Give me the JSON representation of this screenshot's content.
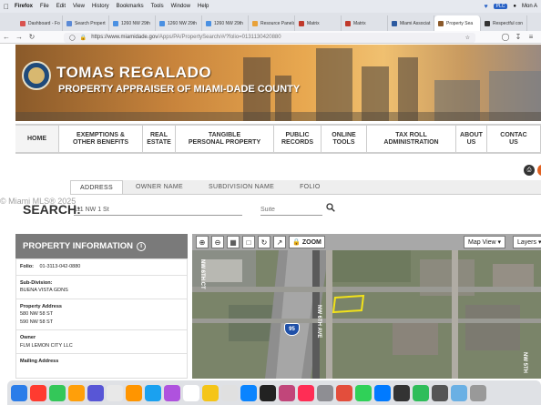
{
  "menubar": {
    "app": "Firefox",
    "items": [
      "File",
      "Edit",
      "View",
      "History",
      "Bookmarks",
      "Tools",
      "Window",
      "Help"
    ],
    "status": "PLC",
    "clock": "Mon A"
  },
  "tabs": [
    {
      "label": "Dashboard - Fo",
      "color": "#d9534f"
    },
    {
      "label": "Search Propert",
      "color": "#5b8ad6"
    },
    {
      "label": "1260 NW 29th",
      "color": "#4a90e2"
    },
    {
      "label": "1260 NW 29th",
      "color": "#4a90e2"
    },
    {
      "label": "1260 NW 29th",
      "color": "#4a90e2"
    },
    {
      "label": "Resource Panels",
      "color": "#e8a23a"
    },
    {
      "label": "Matrix",
      "color": "#c0392b"
    },
    {
      "label": "Matrix",
      "color": "#c0392b"
    },
    {
      "label": "Miami Associat",
      "color": "#2c5aa0"
    },
    {
      "label": "Property Sea",
      "color": "#8b5a2b",
      "active": true
    },
    {
      "label": "Respectful con",
      "color": "#333"
    }
  ],
  "url": {
    "host": "https://www.miamidade.gov",
    "path": "/Apps/PA/PropertySearch/#/?folio=0131130420880"
  },
  "banner": {
    "title": "TOMAS REGALADO",
    "subtitle": "PROPERTY APPRAISER OF MIAMI-DADE COUNTY"
  },
  "sitenav": [
    {
      "line1": "HOME",
      "line2": ""
    },
    {
      "line1": "EXEMPTIONS &",
      "line2": "OTHER BENEFITS"
    },
    {
      "line1": "REAL",
      "line2": "ESTATE"
    },
    {
      "line1": "TANGIBLE",
      "line2": "PERSONAL PROPERTY"
    },
    {
      "line1": "PUBLIC",
      "line2": "RECORDS"
    },
    {
      "line1": "ONLINE",
      "line2": "TOOLS"
    },
    {
      "line1": "TAX ROLL",
      "line2": "ADMINISTRATION"
    },
    {
      "line1": "ABOUT",
      "line2": "US"
    },
    {
      "line1": "CONTAC",
      "line2": "US"
    }
  ],
  "search": {
    "tabs": [
      "ADDRESS",
      "OWNER NAME",
      "SUBDIVISION NAME",
      "FOLIO"
    ],
    "label": "SEARCH:",
    "address_value": "111 NW 1 St",
    "suite_placeholder": "Suite"
  },
  "watermark": "© Miami MLS® 2025",
  "property": {
    "heading": "PROPERTY INFORMATION",
    "folio_label": "Folio:",
    "folio": "01-3113-042-0880",
    "subdivision_label": "Sub-Division:",
    "subdivision": "BUENA VISTA GDNS",
    "address_label": "Property Address",
    "address_lines": [
      "580 NW 58 ST",
      "590 NW 58 ST"
    ],
    "owner_label": "Owner",
    "owner": "FLM LEMON CITY LLC",
    "mailing_label": "Mailing Address"
  },
  "map": {
    "zoom_label": "ZOOM",
    "map_view": "Map View",
    "layers": "Layers",
    "street_labels": [
      "NW 6TH CT",
      "NW 6TH AVE",
      "NW 5TH",
      "95"
    ]
  }
}
